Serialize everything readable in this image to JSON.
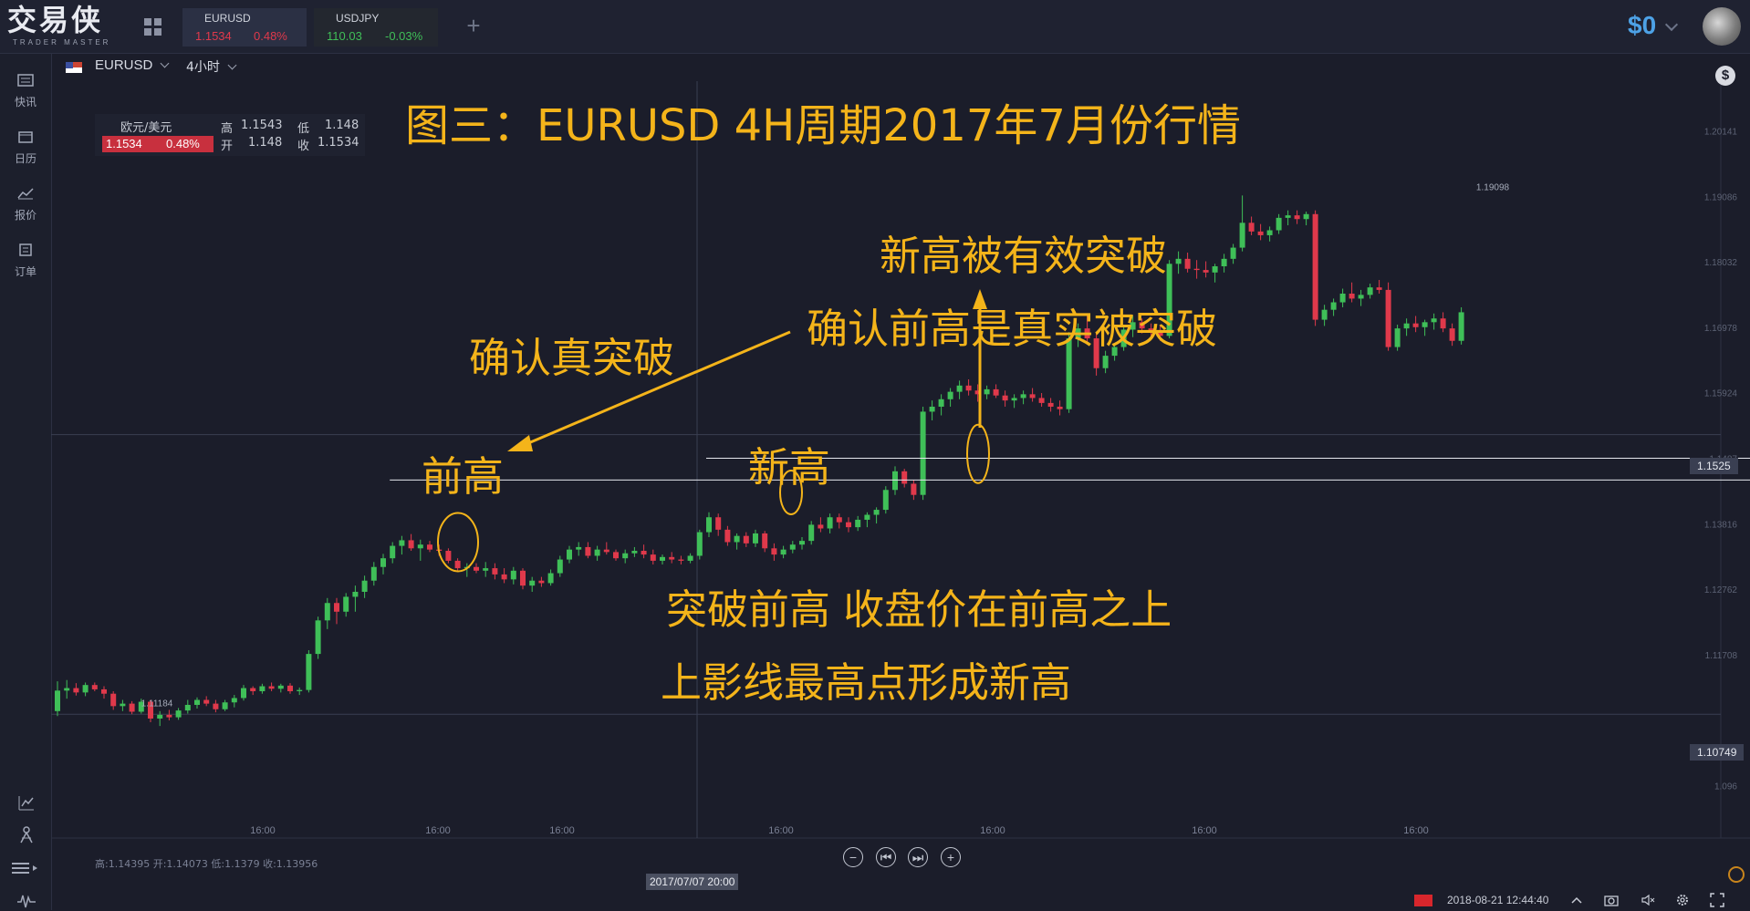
{
  "app": {
    "logo_text": "交易侠",
    "logo_sub": "TRADER MASTER"
  },
  "tabs": [
    {
      "symbol": "EURUSD",
      "price": "1.1534",
      "change": "0.48%",
      "dir": "up",
      "active": true
    },
    {
      "symbol": "USDJPY",
      "price": "110.03",
      "change": "-0.03%",
      "dir": "down",
      "active": false
    }
  ],
  "header": {
    "balance": "$0"
  },
  "sidebar": {
    "items": [
      {
        "label": "快讯",
        "icon": "newsflash-icon"
      },
      {
        "label": "日历",
        "icon": "calendar-icon"
      },
      {
        "label": "报价",
        "icon": "quotes-icon"
      },
      {
        "label": "订单",
        "icon": "orders-icon"
      }
    ]
  },
  "chart_toolbar": {
    "symbol": "EURUSD",
    "timeframe": "4小时"
  },
  "info_box": {
    "name": "欧元/美元",
    "price": "1.1534",
    "change": "0.48%",
    "high_label": "高",
    "high": "1.1543",
    "low_label": "低",
    "low": "1.148",
    "open_label": "开",
    "open": "1.148",
    "close_label": "收",
    "close": "1.1534"
  },
  "annotations": {
    "title": "图三：EURUSD 4H周期2017年7月份行情",
    "prev_high": "前高",
    "confirm_true_break": "确认真突破",
    "new_high": "新高",
    "new_high_broken": "新高被有效突破",
    "confirm_prev_high": "确认前高是真实被突破",
    "break_prev_high": "突破前高 收盘价在前高之上",
    "upper_shadow": "上影线最高点形成新高"
  },
  "status": {
    "ohlc": "高:1.14395 开:1.14073 低:1.1379 收:1.13956",
    "datetime": "2018-08-21 12:44:40",
    "selected_time": "2017/07/07 20:00"
  },
  "chart_data": {
    "type": "candlestick",
    "symbol": "EURUSD",
    "timeframe": "4H",
    "y_ticks": [
      "1.096",
      "1.11708",
      "1.12762",
      "1.13816",
      "1.1487",
      "1.15924",
      "1.16978",
      "1.18032",
      "1.19086",
      "1.20141"
    ],
    "x_ticks": [
      "16:00",
      "16:00",
      "16:00",
      "16:00",
      "16:00",
      "16:00",
      "16:00"
    ],
    "current_price": "1.1525",
    "marker_price": "1.10749",
    "high_label": "1.19098",
    "low_label": "1.11184",
    "ylim": [
      1.0905,
      1.2094
    ],
    "horizontal_lines": [
      1.1487,
      1.1452
    ],
    "candles": [
      [
        1.108,
        1.1128,
        1.1072,
        1.1113
      ],
      [
        1.1113,
        1.113,
        1.11,
        1.1117
      ],
      [
        1.1117,
        1.1125,
        1.1105,
        1.111
      ],
      [
        1.111,
        1.1126,
        1.1104,
        1.1122
      ],
      [
        1.1122,
        1.1126,
        1.1112,
        1.1115
      ],
      [
        1.1115,
        1.112,
        1.11,
        1.1108
      ],
      [
        1.1108,
        1.1112,
        1.1082,
        1.1088
      ],
      [
        1.1088,
        1.1098,
        1.108,
        1.1092
      ],
      [
        1.1092,
        1.1096,
        1.1075,
        1.1079
      ],
      [
        1.1079,
        1.11,
        1.1076,
        1.1095
      ],
      [
        1.1095,
        1.1098,
        1.1062,
        1.1068
      ],
      [
        1.1068,
        1.108,
        1.1056,
        1.1074
      ],
      [
        1.1074,
        1.1082,
        1.1065,
        1.107
      ],
      [
        1.107,
        1.1085,
        1.1066,
        1.1081
      ],
      [
        1.1081,
        1.1098,
        1.1076,
        1.109
      ],
      [
        1.109,
        1.1102,
        1.1084,
        1.1098
      ],
      [
        1.1098,
        1.1104,
        1.1088,
        1.1092
      ],
      [
        1.1092,
        1.1098,
        1.1078,
        1.1083
      ],
      [
        1.1083,
        1.1098,
        1.108,
        1.1094
      ],
      [
        1.1094,
        1.1106,
        1.1086,
        1.1101
      ],
      [
        1.1101,
        1.1122,
        1.1097,
        1.1117
      ],
      [
        1.1117,
        1.112,
        1.1106,
        1.1112
      ],
      [
        1.1112,
        1.1124,
        1.1108,
        1.112
      ],
      [
        1.112,
        1.1126,
        1.1112,
        1.1116
      ],
      [
        1.1116,
        1.1124,
        1.111,
        1.1121
      ],
      [
        1.1121,
        1.1125,
        1.1108,
        1.1112
      ],
      [
        1.1112,
        1.1118,
        1.1106,
        1.1114
      ],
      [
        1.1114,
        1.1178,
        1.111,
        1.1172
      ],
      [
        1.1172,
        1.1232,
        1.1164,
        1.1226
      ],
      [
        1.1226,
        1.1262,
        1.1212,
        1.1254
      ],
      [
        1.1254,
        1.1262,
        1.122,
        1.124
      ],
      [
        1.124,
        1.127,
        1.1232,
        1.1264
      ],
      [
        1.1264,
        1.1282,
        1.124,
        1.1272
      ],
      [
        1.1272,
        1.1298,
        1.1262,
        1.129
      ],
      [
        1.129,
        1.132,
        1.1282,
        1.1312
      ],
      [
        1.1312,
        1.1333,
        1.13,
        1.1326
      ],
      [
        1.1326,
        1.1352,
        1.1318,
        1.1346
      ],
      [
        1.1346,
        1.1362,
        1.1332,
        1.1355
      ],
      [
        1.1355,
        1.1365,
        1.1338,
        1.1342
      ],
      [
        1.1342,
        1.1356,
        1.1322,
        1.1348
      ],
      [
        1.1348,
        1.1354,
        1.1336,
        1.134
      ],
      [
        1.134,
        1.1348,
        1.133,
        1.1338
      ],
      [
        1.1338,
        1.1342,
        1.1318,
        1.1322
      ],
      [
        1.1322,
        1.1326,
        1.1304,
        1.131
      ],
      [
        1.131,
        1.1318,
        1.1296,
        1.1312
      ],
      [
        1.1312,
        1.1318,
        1.1302,
        1.1306
      ],
      [
        1.1306,
        1.132,
        1.1296,
        1.131
      ],
      [
        1.131,
        1.1318,
        1.1292,
        1.13
      ],
      [
        1.13,
        1.131,
        1.1286,
        1.1292
      ],
      [
        1.1292,
        1.1312,
        1.1284,
        1.1306
      ],
      [
        1.1306,
        1.131,
        1.1276,
        1.1282
      ],
      [
        1.1282,
        1.1296,
        1.1272,
        1.129
      ],
      [
        1.129,
        1.1296,
        1.128,
        1.1286
      ],
      [
        1.1286,
        1.1308,
        1.1282,
        1.1302
      ],
      [
        1.1302,
        1.133,
        1.1296,
        1.1324
      ],
      [
        1.1324,
        1.1346,
        1.1318,
        1.134
      ],
      [
        1.134,
        1.1352,
        1.133,
        1.1344
      ],
      [
        1.1344,
        1.1352,
        1.1326,
        1.133
      ],
      [
        1.133,
        1.1346,
        1.1322,
        1.134
      ],
      [
        1.134,
        1.1352,
        1.1332,
        1.1336
      ],
      [
        1.1336,
        1.134,
        1.1322,
        1.1326
      ],
      [
        1.1326,
        1.134,
        1.1318,
        1.1334
      ],
      [
        1.1334,
        1.1344,
        1.1328,
        1.1338
      ],
      [
        1.1338,
        1.1348,
        1.1326,
        1.1332
      ],
      [
        1.1332,
        1.134,
        1.1316,
        1.1322
      ],
      [
        1.1322,
        1.1332,
        1.1316,
        1.1328
      ],
      [
        1.1328,
        1.1336,
        1.1318,
        1.1324
      ],
      [
        1.1324,
        1.133,
        1.1316,
        1.1322
      ],
      [
        1.1322,
        1.1334,
        1.1318,
        1.133
      ],
      [
        1.133,
        1.1372,
        1.1324,
        1.1368
      ],
      [
        1.1368,
        1.14,
        1.136,
        1.1392
      ],
      [
        1.1392,
        1.1398,
        1.1362,
        1.1372
      ],
      [
        1.1372,
        1.1378,
        1.1346,
        1.1352
      ],
      [
        1.1352,
        1.1366,
        1.134,
        1.1362
      ],
      [
        1.1362,
        1.1368,
        1.1344,
        1.135
      ],
      [
        1.135,
        1.1372,
        1.1344,
        1.1366
      ],
      [
        1.1366,
        1.137,
        1.1336,
        1.1342
      ],
      [
        1.1342,
        1.135,
        1.1322,
        1.1332
      ],
      [
        1.1332,
        1.1346,
        1.1326,
        1.134
      ],
      [
        1.134,
        1.1354,
        1.1334,
        1.1348
      ],
      [
        1.1348,
        1.136,
        1.134,
        1.1354
      ],
      [
        1.1354,
        1.1386,
        1.1348,
        1.138
      ],
      [
        1.138,
        1.1392,
        1.1368,
        1.1374
      ],
      [
        1.1374,
        1.1398,
        1.1366,
        1.1392
      ],
      [
        1.1392,
        1.1398,
        1.1374,
        1.1384
      ],
      [
        1.1384,
        1.1392,
        1.1368,
        1.1376
      ],
      [
        1.1376,
        1.1394,
        1.137,
        1.1388
      ],
      [
        1.1388,
        1.14,
        1.1376,
        1.1396
      ],
      [
        1.1396,
        1.1408,
        1.1382,
        1.1404
      ],
      [
        1.1404,
        1.1442,
        1.1398,
        1.1436
      ],
      [
        1.1436,
        1.1474,
        1.1428,
        1.1466
      ],
      [
        1.1466,
        1.147,
        1.144,
        1.1446
      ],
      [
        1.1446,
        1.1452,
        1.142,
        1.1428
      ]
    ]
  }
}
